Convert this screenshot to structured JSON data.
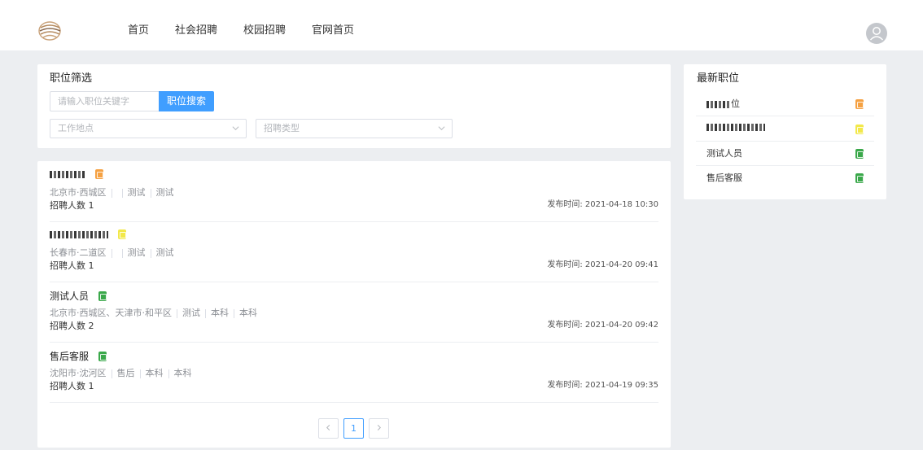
{
  "header": {
    "nav": [
      "首页",
      "社会招聘",
      "校园招聘",
      "官网首页"
    ]
  },
  "filter": {
    "title": "职位筛选",
    "search_placeholder": "请输入职位关键字",
    "search_button": "职位搜索",
    "location_placeholder": "工作地点",
    "type_placeholder": "招聘类型"
  },
  "jobs": [
    {
      "title": "",
      "badge_color": "#f5a142",
      "location": "北京市·西城区",
      "tags": [
        "",
        "测试",
        "测试"
      ],
      "count": "招聘人数 1",
      "time": "发布时间: 2021-04-18 10:30"
    },
    {
      "title": "",
      "badge_color": "#f2e84a",
      "location": "长春市·二道区",
      "tags": [
        "",
        "测试",
        "测试"
      ],
      "count": "招聘人数 1",
      "time": "发布时间: 2021-04-20 09:41"
    },
    {
      "title": "测试人员",
      "badge_color": "#3aa84a",
      "location": "北京市·西城区、天津市·和平区",
      "tags": [
        "测试",
        "本科",
        "本科"
      ],
      "count": "招聘人数 2",
      "time": "发布时间: 2021-04-20 09:42"
    },
    {
      "title": "售后客服",
      "badge_color": "#3aa84a",
      "location": "沈阳市·沈河区",
      "tags": [
        "售后",
        "本科",
        "本科"
      ],
      "count": "招聘人数 1",
      "time": "发布时间: 2021-04-19 09:35"
    }
  ],
  "pagination": {
    "prev_icon": "chevron-left-icon",
    "current": "1",
    "next_icon": "chevron-right-icon"
  },
  "latest": {
    "title": "最新职位",
    "items": [
      {
        "label": "位",
        "badge_color": "#f5a142"
      },
      {
        "label": "",
        "badge_color": "#f2e84a"
      },
      {
        "label": "测试人员",
        "badge_color": "#3aa84a"
      },
      {
        "label": "售后客服",
        "badge_color": "#3aa84a"
      }
    ]
  },
  "colors": {
    "accent": "#409eff",
    "background": "#eceef1"
  }
}
